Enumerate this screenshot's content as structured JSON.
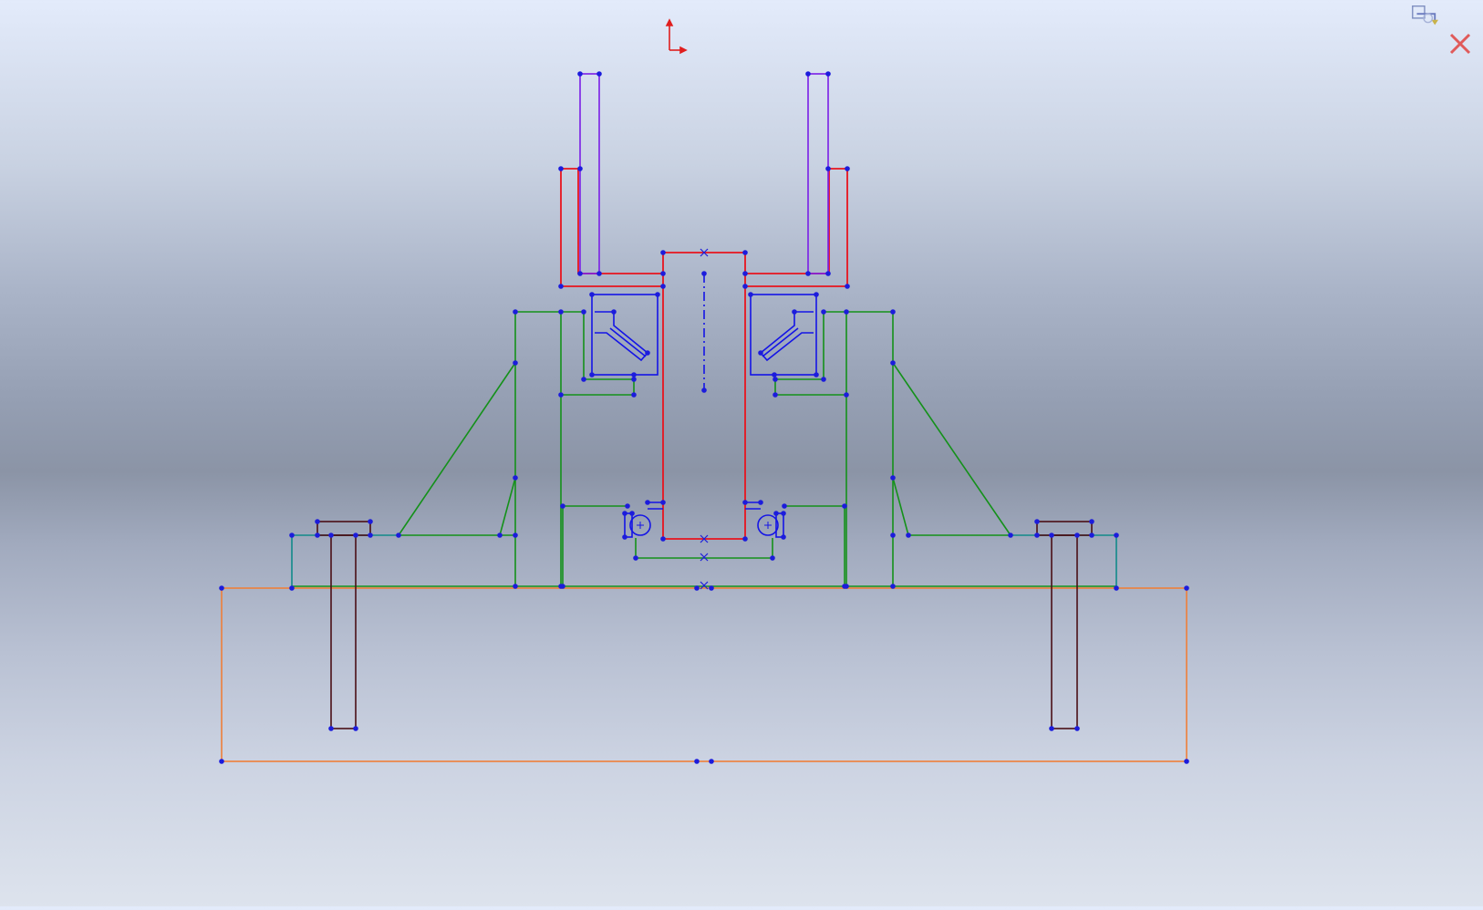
{
  "viewport": {
    "background_top": "#e3ebfb",
    "background_mid": "#8b94a6",
    "background_bottom": "#dde3ed"
  },
  "colors": {
    "shaft": "#e8141e",
    "shaft_sleeve": "#7a1ee6",
    "housing": "#14911a",
    "bearing": "#1414e6",
    "base_plate": "#ee7f3a",
    "flange": "#118a8a",
    "bolt": "#4a0f16",
    "vertex": "#1c1cdc",
    "origin": "#e01e1e"
  },
  "icons": {
    "confirm": "confirm-corner-icon",
    "exit": "exit-sketch-icon",
    "origin": "sketch-origin-icon"
  },
  "confirm_corner": {
    "tooltip": ""
  }
}
